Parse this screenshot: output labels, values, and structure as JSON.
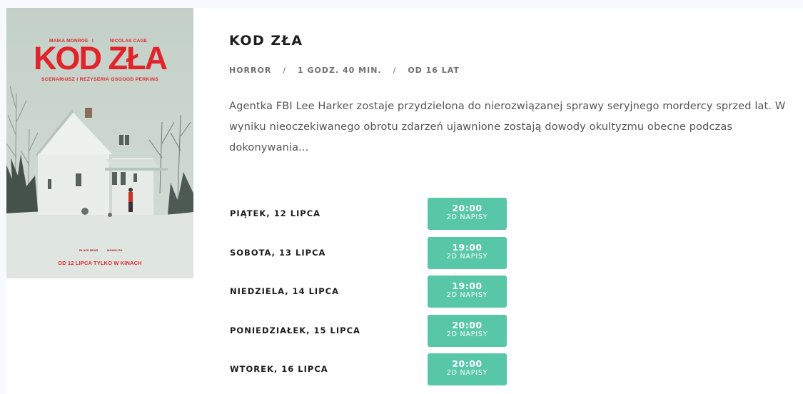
{
  "poster": {
    "actor_1": "MAIKA MONROE",
    "separator": "I",
    "actor_2": "NICOLAS CAGE",
    "title": "KOD ZŁA",
    "credit": "SCENARIUSZ I REŻYSERIA OSGOOD PERKINS",
    "logo_1": "BLACK BEAR",
    "logo_2": "MONOLITH",
    "release": "OD 12 LIPCA TYLKO W KINACH"
  },
  "movie": {
    "title": "KOD ZŁA",
    "genre": "HORROR",
    "duration": "1 GODZ. 40 MIN.",
    "age": "OD 16 LAT",
    "separator": "/",
    "description": "Agentka FBI Lee Harker zostaje przydzielona do nierozwiązanej sprawy seryjnego mordercy sprzed lat. W wyniku nieoczekiwanego obrotu zdarzeń ujawnione zostają dowody okultyzmu obecne podczas dokonywania..."
  },
  "showtimes": [
    {
      "day": "PIĄTEK, 12 LIPCA",
      "time": "20:00",
      "format": "2D NAPISY"
    },
    {
      "day": "SOBOTA, 13 LIPCA",
      "time": "19:00",
      "format": "2D NAPISY"
    },
    {
      "day": "NIEDZIELA, 14 LIPCA",
      "time": "19:00",
      "format": "2D NAPISY"
    },
    {
      "day": "PONIEDZIAŁEK, 15 LIPCA",
      "time": "20:00",
      "format": "2D NAPISY"
    },
    {
      "day": "WTOREK, 16 LIPCA",
      "time": "20:00",
      "format": "2D NAPISY"
    }
  ],
  "colors": {
    "accent": "#58c7a7",
    "poster_red": "#e0242a"
  }
}
